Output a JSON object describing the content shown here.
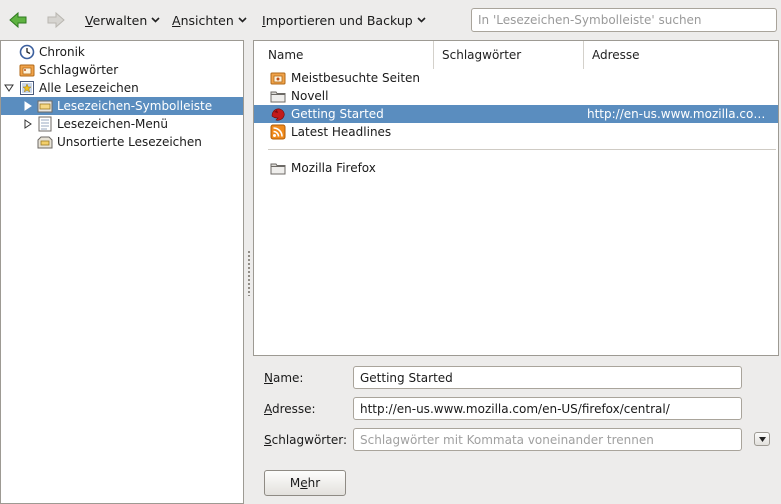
{
  "toolbar": {
    "back_icon": "back-arrow-icon",
    "forward_icon": "forward-arrow-icon",
    "menus": [
      {
        "label": "Verwalten",
        "accel": "V",
        "rest": "erwalten"
      },
      {
        "label": "Ansichten",
        "accel": "A",
        "rest": "nsichten"
      },
      {
        "label": "Importieren und Backup",
        "accel": "I",
        "rest": "mportieren und Backup"
      }
    ],
    "search_placeholder": "In 'Lesezeichen-Symbolleiste' suchen"
  },
  "sidebar": {
    "items": [
      {
        "label": "Chronik",
        "icon": "clock-icon"
      },
      {
        "label": "Schlagwörter",
        "icon": "tag-folder-icon"
      },
      {
        "label": "Alle Lesezeichen",
        "icon": "bookmarks-icon",
        "expanded": true
      },
      {
        "label": "Lesezeichen-Symbolleiste",
        "icon": "toolbar-folder-icon",
        "selected": true
      },
      {
        "label": "Lesezeichen-Menü",
        "icon": "menu-folder-icon"
      },
      {
        "label": "Unsortierte Lesezeichen",
        "icon": "unsorted-folder-icon"
      }
    ]
  },
  "list": {
    "columns": [
      "Name",
      "Schlagwörter",
      "Adresse"
    ],
    "rows": [
      {
        "name": "Meistbesuchte Seiten",
        "address": "",
        "icon": "smart-folder-icon"
      },
      {
        "name": "Novell",
        "address": "",
        "icon": "folder-icon"
      },
      {
        "name": "Getting Started",
        "address": "http://en-us.www.mozilla.com/en-US/firefox/central/",
        "icon": "firefox-icon",
        "selected": true
      },
      {
        "name": "Latest Headlines",
        "address": "",
        "icon": "rss-icon"
      },
      {
        "name": "Mozilla Firefox",
        "address": "",
        "icon": "folder-icon"
      }
    ]
  },
  "details": {
    "name_label": "Name:",
    "name_accel": "N",
    "name_rest": "ame:",
    "name_value": "Getting Started",
    "address_label": "Adresse:",
    "address_accel": "A",
    "address_rest": "dresse:",
    "address_value": "http://en-us.www.mozilla.com/en-US/firefox/central/",
    "tags_label": "Schlagwörter:",
    "tags_accel": "S",
    "tags_rest": "chlagwörter:",
    "tags_placeholder": "Schlagwörter mit Kommata voneinander trennen",
    "more_pre": "M",
    "more_accel": "e",
    "more_post": "hr"
  },
  "colors": {
    "selection": "#5a8dbf",
    "back_arrow": "#4fa33a",
    "background": "#edeceb"
  }
}
